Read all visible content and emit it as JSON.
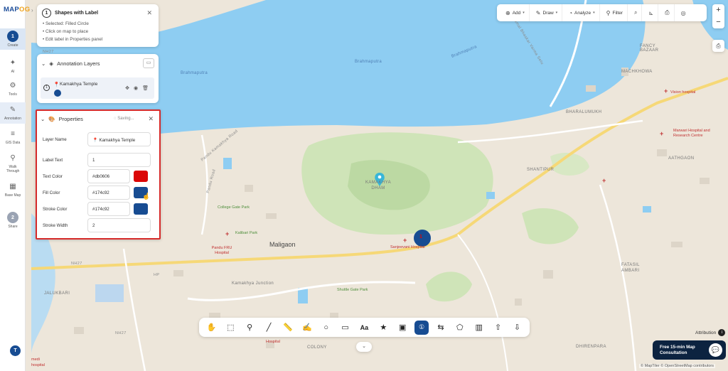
{
  "app": {
    "logo_main": "MAP",
    "logo_accent": "OG"
  },
  "rail": {
    "items": [
      {
        "label": "Create",
        "icon": "1"
      },
      {
        "label": "AI",
        "icon": "ai-icon"
      },
      {
        "label": "Tools",
        "icon": "tools-icon"
      },
      {
        "label": "Annotation",
        "icon": "annotation-icon"
      },
      {
        "label": "GIS Data",
        "icon": "gis-data-icon"
      },
      {
        "label": "Walk Through",
        "icon": "walk-through-icon"
      },
      {
        "label": "Base Map",
        "icon": "base-map-icon"
      },
      {
        "label": "Share",
        "icon": "2"
      }
    ],
    "avatar": "T"
  },
  "info_panel": {
    "step": "1",
    "title": "Shapes with Label",
    "lines": [
      "• Selected: Filled Circle",
      "• Click on map to place",
      "• Edit label in Properties panel"
    ]
  },
  "layers_panel": {
    "title": "Annotation Layers",
    "layer_name": "Kamakhya Temple"
  },
  "properties_panel": {
    "title": "Properties",
    "status": "Saving...",
    "fields": {
      "layer_name_label": "Layer Name",
      "layer_name_value": "Kamakhya Temple",
      "label_text_label": "Label Text",
      "label_text_value": "1",
      "text_color_label": "Text Color",
      "text_color_value": "#db0606",
      "fill_color_label": "Fill Color",
      "fill_color_value": "#174c92",
      "stroke_color_label": "Stroke Color",
      "stroke_color_value": "#174c92",
      "stroke_width_label": "Stroke Width",
      "stroke_width_value": "2"
    }
  },
  "toolbar": {
    "add": "Add",
    "draw": "Draw",
    "analyze": "Analyze",
    "filter": "Filter"
  },
  "zoom": {
    "in": "+",
    "out": "−"
  },
  "map_labels": {
    "brahmaputra_1": "Brahmaputra",
    "brahmaputra_2": "Brahmaputra",
    "brahmaputra_3": "Brahmaputra",
    "kamal_road": "Kamal Bhaskar Varma Setu",
    "fancy_bazaar": "FANCY BAZAAR",
    "machkhowa": "MACHKHOWA",
    "vision_hospital": "Vision hospital",
    "bharalumukh": "BHARALUMUKH",
    "marwari_hospital": "Marwari Hospital and Research Centre",
    "aathgaon": "AATHGAON",
    "shantipur": "SHANTIPUR",
    "kamakhya_dham": "KAMAKHYA DHAM",
    "maligaon": "Maligaon",
    "college_gate_park": "College Gate Park",
    "kalibari_park": "Kalibari Park",
    "pandu_fru_hospital": "Pandu FRU Hospital",
    "sanjeevani_hospital": "Sanjeevani Hospital",
    "kamakhya_junction": "Kamakhya Junction",
    "shuttle_gate_park": "Shuttle Gate Park",
    "jalukbari": "JALUKBARI",
    "fatasil_ambari": "FATASIL AMBARI",
    "dhirenpara": "DHIRENPARA",
    "colony": "COLONY",
    "hospital": "Hospital",
    "nh27_1": "NH27",
    "nh27_2": "NH27",
    "nh27_3": "NH27",
    "hp": "HP",
    "pandu_kamakhya_road": "Pandu Kamakhya Road",
    "pandu_road": "Pandu Road",
    "medi_hospital": "medi",
    "medi_hospital_2": "hospital"
  },
  "marker": {
    "label": "1",
    "fill": "#174c92",
    "text_color": "#db0606"
  },
  "bottom_tools": [
    "hand-icon",
    "select-icon",
    "pin-icon",
    "line-icon",
    "ruler-icon",
    "freehand-icon",
    "circle-icon",
    "rectangle-icon",
    "text-icon",
    "star-icon",
    "image-icon",
    "shape-label-icon",
    "route-icon",
    "polygon-icon",
    "building-icon",
    "upload-icon",
    "download-icon"
  ],
  "attribution": "Attribution",
  "consult": {
    "line1": "Free 15-min Map",
    "line2": "Consultation"
  },
  "copyright": "© MapTiler © OpenStreetMap contributors",
  "colors": {
    "water": "#8ecdf2",
    "land": "#ede6da",
    "accent": "#174c92",
    "highlight": "#d62a2a"
  }
}
